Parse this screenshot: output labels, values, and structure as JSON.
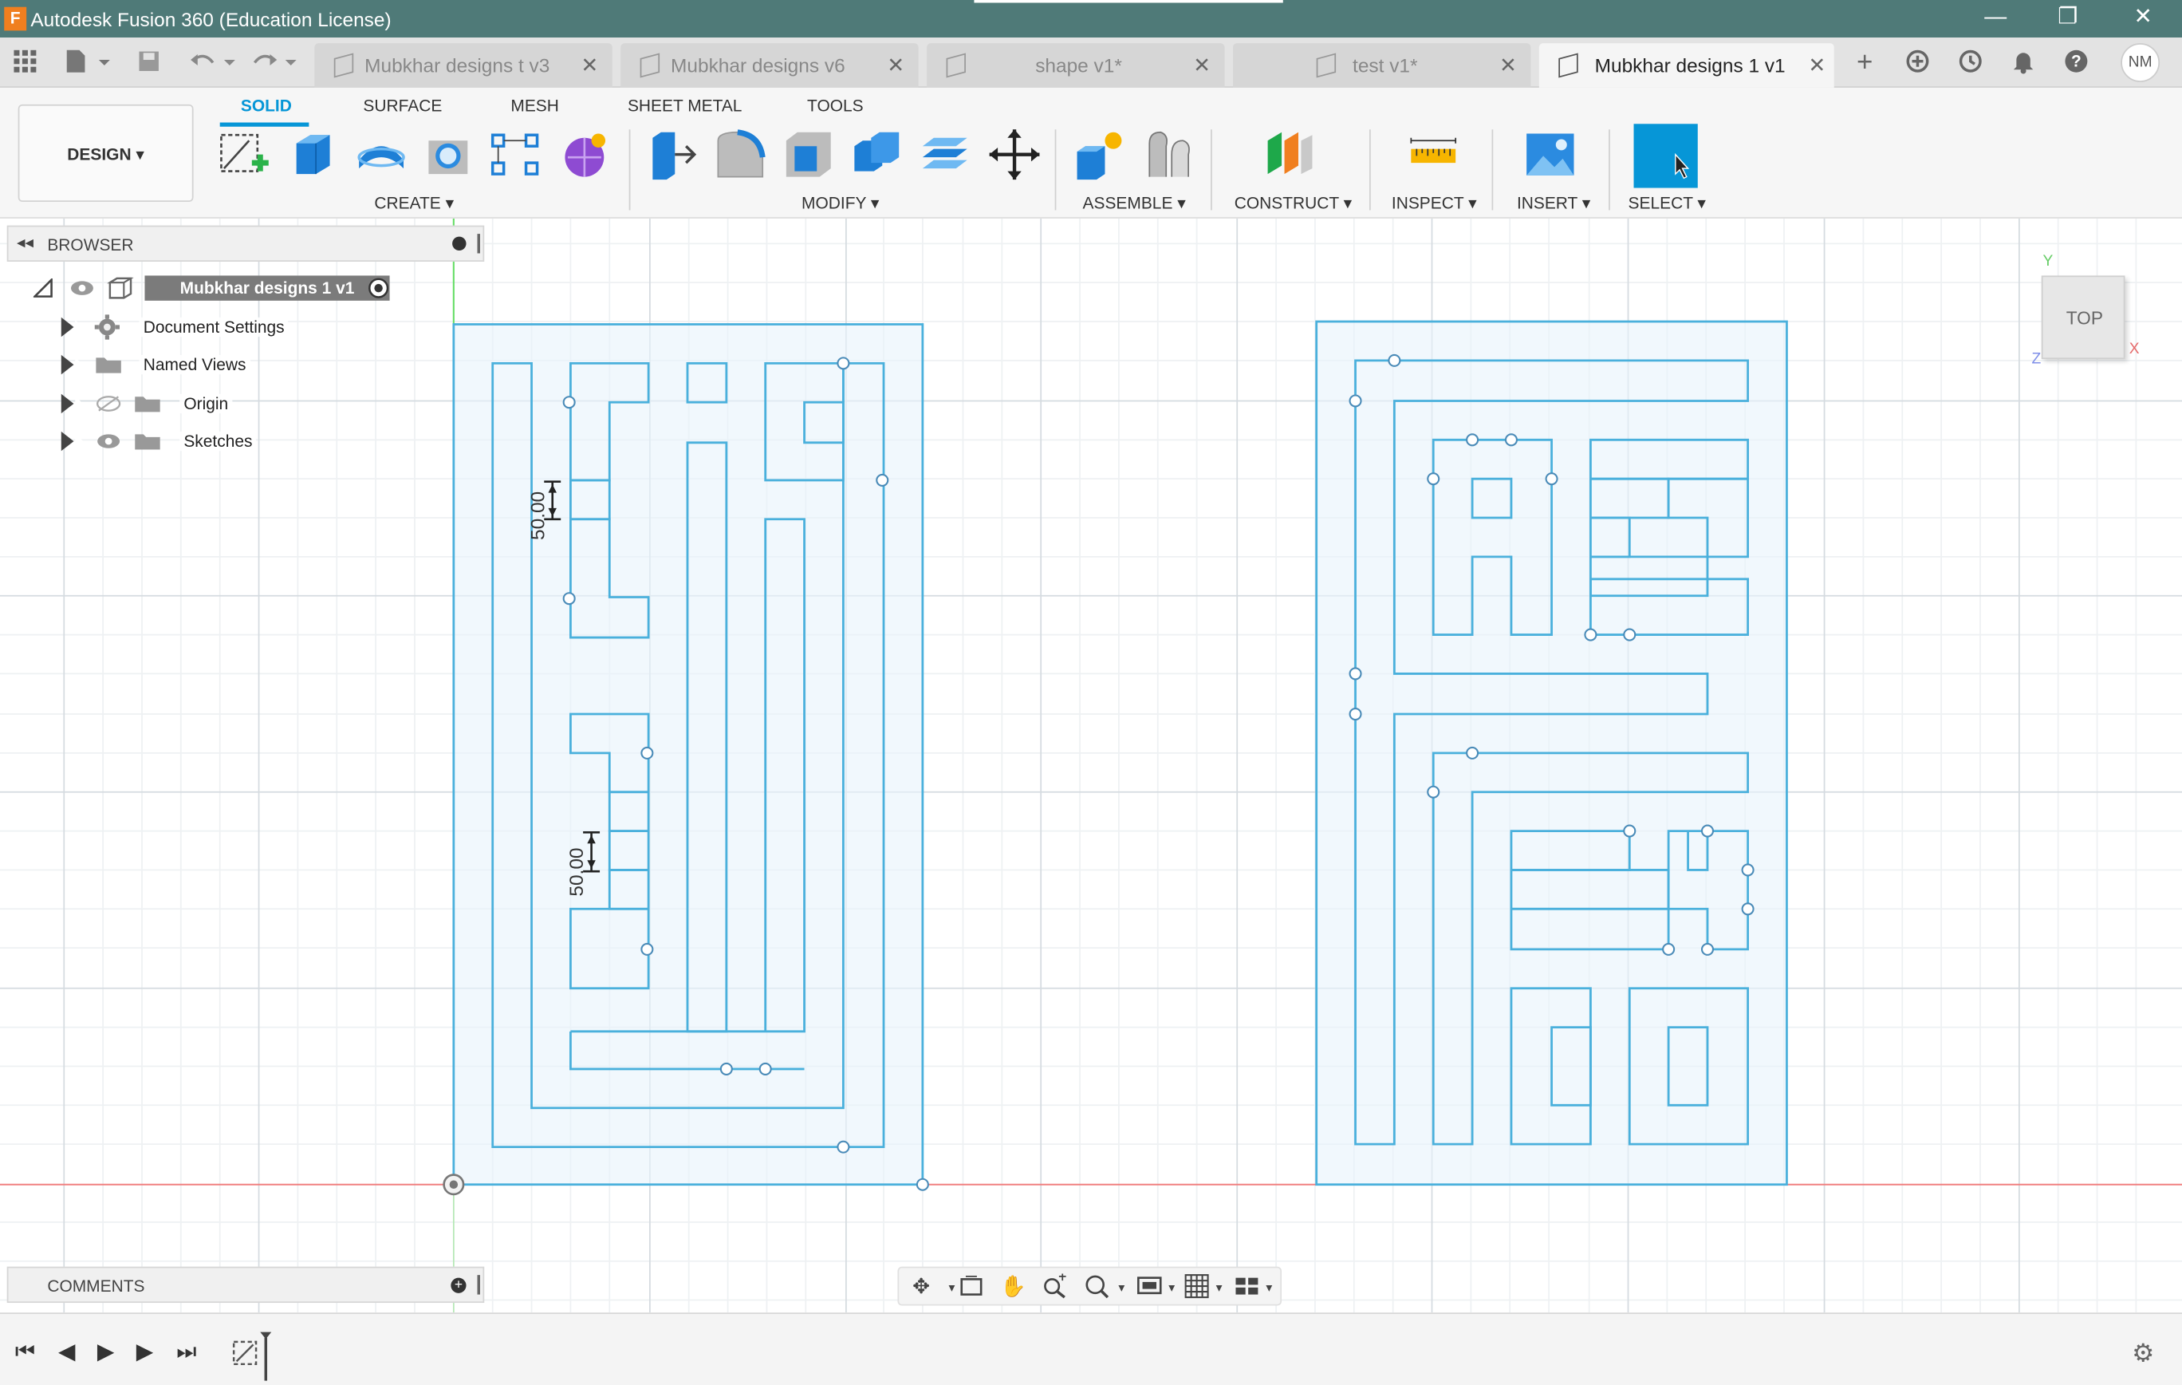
{
  "app": {
    "title": "Autodesk Fusion 360 (Education License)",
    "logo_letter": "F",
    "window_controls": [
      "—",
      "❐",
      "✕"
    ]
  },
  "tabs": [
    {
      "label": "Mubkhar designs t v3",
      "active": false
    },
    {
      "label": "Mubkhar designs v6",
      "active": false
    },
    {
      "label": "shape v1*",
      "active": false
    },
    {
      "label": "test v1*",
      "active": false
    },
    {
      "label": "Mubkhar designs 1 v1",
      "active": true
    }
  ],
  "user": {
    "initials": "NM"
  },
  "workspace": {
    "label": "DESIGN ▾"
  },
  "ribbon_tabs": [
    {
      "label": "SOLID",
      "active": true
    },
    {
      "label": "SURFACE",
      "active": false
    },
    {
      "label": "MESH",
      "active": false
    },
    {
      "label": "SHEET METAL",
      "active": false
    },
    {
      "label": "TOOLS",
      "active": false
    }
  ],
  "groups": {
    "create": "CREATE ▾",
    "modify": "MODIFY ▾",
    "assemble": "ASSEMBLE ▾",
    "construct": "CONSTRUCT ▾",
    "inspect": "INSPECT ▾",
    "insert": "INSERT ▾",
    "select": "SELECT ▾"
  },
  "browser": {
    "title": "BROWSER",
    "root": "Mubkhar designs 1 v1",
    "items": [
      {
        "label": "Document Settings",
        "icon": "gear-icon"
      },
      {
        "label": "Named Views",
        "icon": "folder-icon"
      },
      {
        "label": "Origin",
        "icon": "folder-icon"
      },
      {
        "label": "Sketches",
        "icon": "folder-icon"
      }
    ]
  },
  "comments": {
    "title": "COMMENTS"
  },
  "viewcube": {
    "face": "TOP",
    "axes": {
      "x": "X",
      "y": "Y",
      "z": "Z"
    }
  },
  "sketch": {
    "dimension_1": "50.00",
    "dimension_2": "50.00"
  },
  "colors": {
    "titlebar": "#4f7a78",
    "accent": "#0696d7",
    "sketch_line": "#4ab0dc",
    "sketch_fill": "#e8f4fb",
    "x_axis": "#f08080",
    "y_axis": "#66dd66"
  }
}
